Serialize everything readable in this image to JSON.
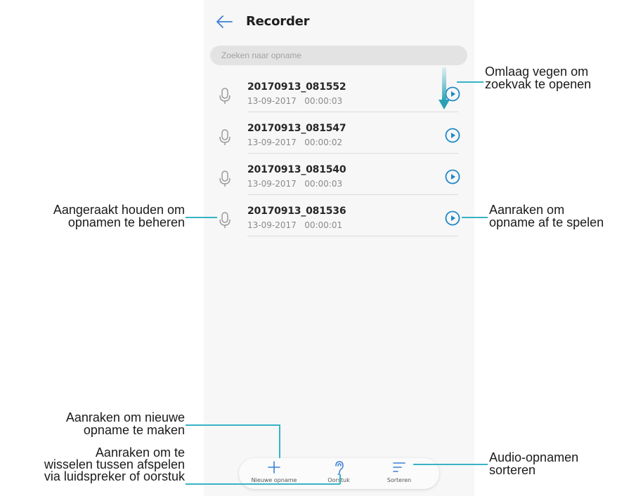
{
  "app": {
    "title": "Recorder"
  },
  "search": {
    "placeholder": "Zoeken naar opname"
  },
  "recordings": [
    {
      "name": "20170913_081552",
      "date": "13-09-2017",
      "duration": "00:00:03"
    },
    {
      "name": "20170913_081547",
      "date": "13-09-2017",
      "duration": "00:00:02"
    },
    {
      "name": "20170913_081540",
      "date": "13-09-2017",
      "duration": "00:00:03"
    },
    {
      "name": "20170913_081536",
      "date": "13-09-2017",
      "duration": "00:00:01"
    }
  ],
  "toolbar": {
    "new_label": "Nieuwe opname",
    "earpiece_label": "Oorstuk",
    "sort_label": "Sorteren"
  },
  "callouts": {
    "swipe": [
      "Omlaag vegen om",
      "zoekvak te openen"
    ],
    "hold": [
      "Aangeraakt houden om",
      "opnamen te beheren"
    ],
    "play": [
      "Aanraken om",
      "opname af te spelen"
    ],
    "new": [
      "Aanraken om nieuwe",
      "opname te maken"
    ],
    "switch": [
      "Aanraken om te",
      "wisselen tussen afspelen",
      "via luidspreker of oorstuk"
    ],
    "sort": [
      "Audio-opnamen",
      "sorteren"
    ]
  },
  "colors": {
    "accent": "#1e88c8",
    "callout_line": "#36b3c6",
    "swipe_arrow": "#4fb3c4"
  },
  "icons": {
    "back": "back-arrow-icon",
    "mic": "microphone-icon",
    "play": "play-circle-icon",
    "new": "plus-icon",
    "earpiece": "ear-icon",
    "sort": "sort-lines-icon"
  }
}
